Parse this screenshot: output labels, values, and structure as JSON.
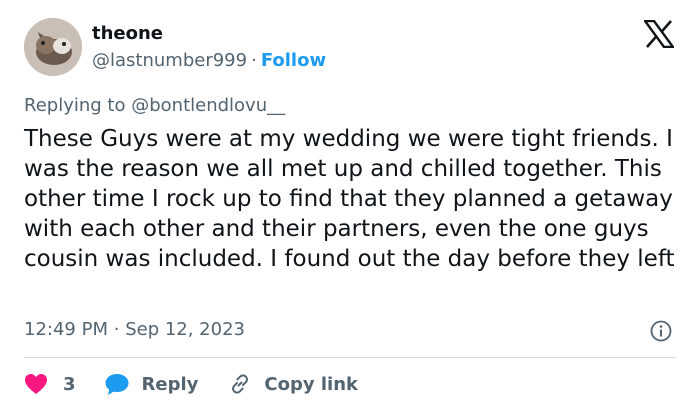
{
  "user": {
    "display_name": "theone",
    "handle": "@lastnumber999",
    "separator": "·",
    "follow_label": "Follow"
  },
  "reply_context": {
    "prefix": "Replying to",
    "handle": "@bontlendlovu__"
  },
  "tweet": {
    "text": "These Guys were at my wedding we were tight friends. I was the reason we all met up and chilled together. This other time I rock up to find that they planned a getaway with each other and their partners, even the one guys cousin was included. I found out the day before they left",
    "time": "12:49 PM",
    "separator": "·",
    "date": "Sep 12, 2023"
  },
  "actions": {
    "like_count": "3",
    "reply_label": "Reply",
    "copy_label": "Copy link"
  },
  "icons": {
    "brand": "x-logo-icon",
    "info": "info-icon",
    "like": "heart-icon",
    "reply": "speech-bubble-icon",
    "copy": "link-icon"
  },
  "colors": {
    "primary_text": "#0f1419",
    "secondary_text": "#536471",
    "follow_blue": "#1d9bf0",
    "heart_red": "#f91880",
    "divider": "#cfd9de"
  }
}
